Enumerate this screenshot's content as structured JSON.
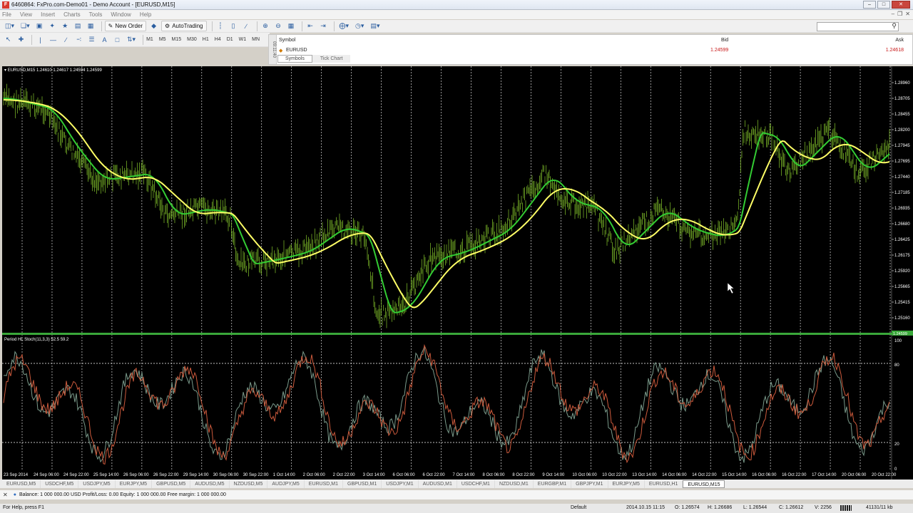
{
  "window": {
    "title": "6460864: FxPro.com-Demo01 - Demo Account - [EURUSD,M15]",
    "app_icon": "F"
  },
  "menu": [
    "File",
    "View",
    "Insert",
    "Charts",
    "Tools",
    "Window",
    "Help"
  ],
  "toolbar": {
    "new_order": "New Order",
    "autotrading": "AutoTrading",
    "timeframes": [
      "M1",
      "M5",
      "M15",
      "M30",
      "H1",
      "H4",
      "D1",
      "W1",
      "MN"
    ]
  },
  "market_watch": {
    "side_label": "09:11:40",
    "col_symbol": "Symbol",
    "col_bid": "Bid",
    "col_ask": "Ask",
    "row": {
      "symbol": "EURUSD",
      "bid": "1.24599",
      "ask": "1.24618"
    },
    "tabs": [
      "Symbols",
      "Tick Chart"
    ]
  },
  "chart": {
    "header": "EURUSD,M15  1.24610 1.24617 1.24594 1.24599",
    "indicator_header": "Period HL Stoch(11,3,3) 52.5 59.2",
    "price_labels": [
      "1.28960",
      "1.28705",
      "1.28455",
      "1.28200",
      "1.27945",
      "1.27695",
      "1.27440",
      "1.27185",
      "1.26935",
      "1.26680",
      "1.26425",
      "1.26175",
      "1.25920",
      "1.25665",
      "1.25415",
      "1.25160"
    ],
    "current_price": "1.24599",
    "stoch_labels": [
      "100",
      "80",
      "20",
      "0"
    ],
    "time_labels": [
      "23 Sep 2014",
      "24 Sep 06:00",
      "24 Sep 22:00",
      "25 Sep 14:00",
      "26 Sep 06:00",
      "26 Sep 22:00",
      "29 Sep 14:00",
      "30 Sep 06:00",
      "30 Sep 22:00",
      "1 Oct 14:00",
      "2 Oct 06:00",
      "2 Oct 22:00",
      "3 Oct 14:00",
      "6 Oct 06:00",
      "6 Oct 22:00",
      "7 Oct 14:00",
      "8 Oct 06:00",
      "8 Oct 22:00",
      "9 Oct 14:00",
      "10 Oct 06:00",
      "10 Oct 22:00",
      "13 Oct 14:00",
      "14 Oct 06:00",
      "14 Oct 22:00",
      "15 Oct 14:00",
      "16 Oct 06:00",
      "16 Oct 22:00",
      "17 Oct 14:00",
      "20 Oct 06:00",
      "20 Oct 22:00"
    ],
    "colors": {
      "background": "#000000",
      "ma_fast": "#33cc33",
      "ma_slow": "#ffff66",
      "price": "#7fbf2a",
      "stoch_main": "#cc5a3c",
      "stoch_signal": "#7a9a8a"
    }
  },
  "symbol_tabs": [
    "EURUSD,M5",
    "USDCHF,M5",
    "USDJPY,M5",
    "EURJPY,M5",
    "GBPUSD,M5",
    "AUDUSD,M5",
    "NZDUSD,M5",
    "AUDJPY,M5",
    "EURUSD,M1",
    "GBPUSD,M1",
    "USDJPY,M1",
    "AUDUSD,M1",
    "USDCHF,M1",
    "NZDUSD,M1",
    "EURGBP,M1",
    "GBPJPY,M1",
    "EURJPY,M5",
    "EURUSD,H1",
    "EURUSD,M15"
  ],
  "terminal": "Balance: 1 000 000.00 USD  Profit/Loss: 0.00  Equity: 1 000 000.00  Free margin: 1 000 000.00",
  "status": {
    "help": "For Help, press F1",
    "profile": "Default",
    "time": "2014.10.15 11:15",
    "open": "O: 1.26574",
    "high": "H: 1.26686",
    "low": "L: 1.26544",
    "close": "C: 1.26612",
    "volume": "V: 2256",
    "traffic": "41131/11 kb"
  }
}
